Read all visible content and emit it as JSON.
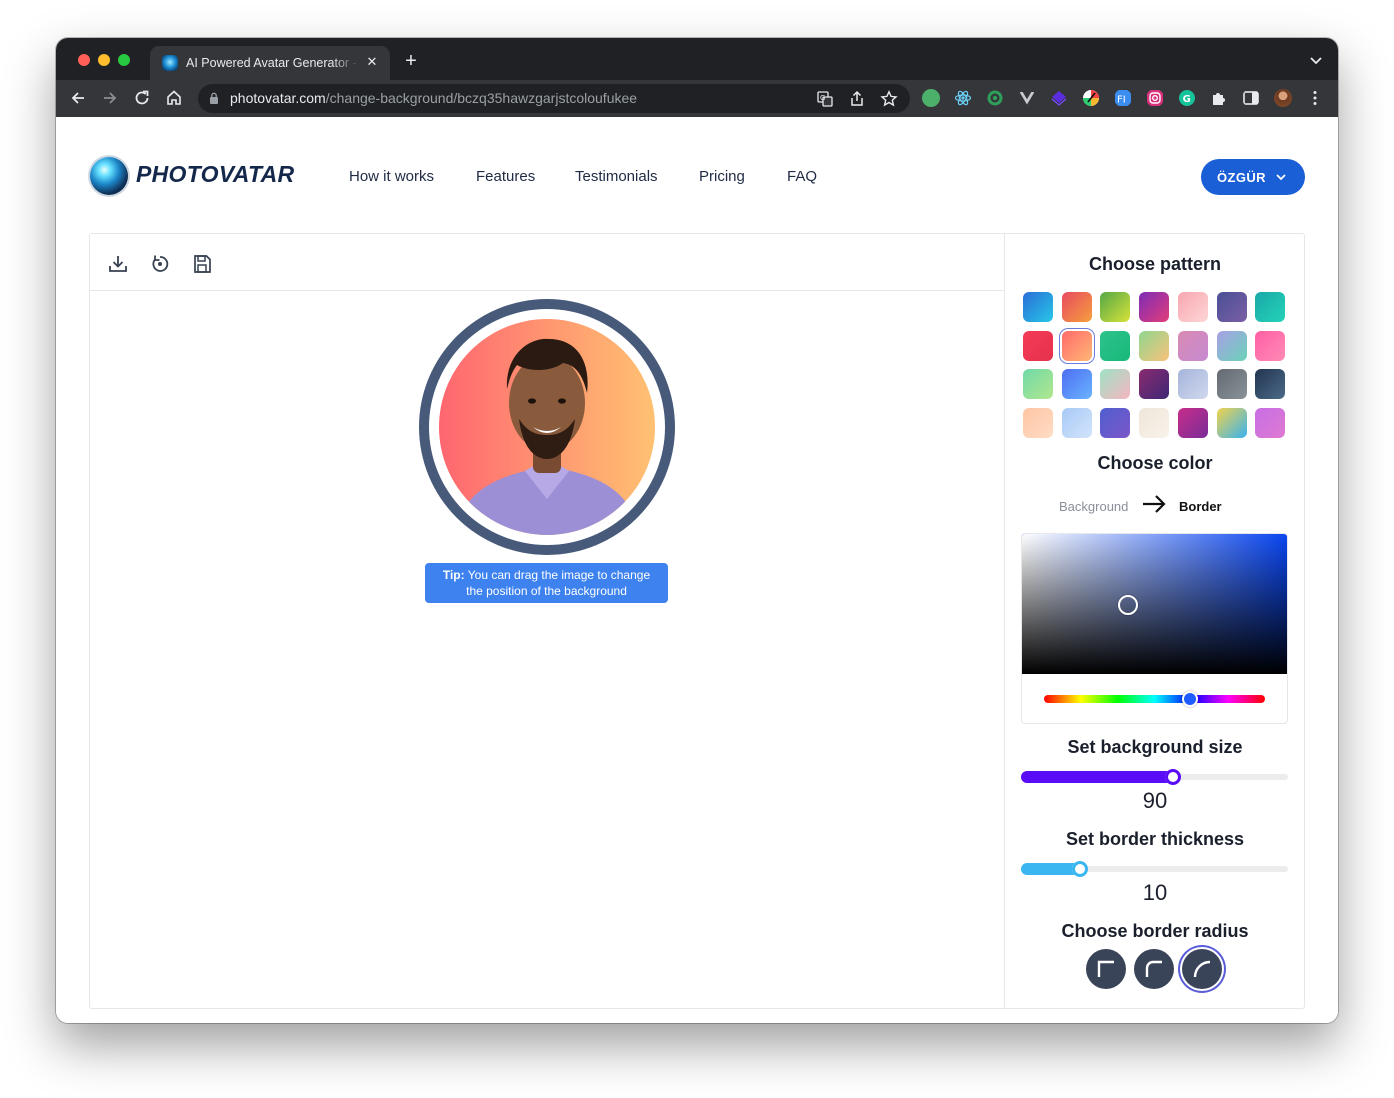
{
  "browser": {
    "tab_title": "AI Powered Avatar Generator -",
    "url_host": "photovatar.com",
    "url_path": "/change-background/bczq35hawzgarjstcoloufukee"
  },
  "site": {
    "logo_text": "PHOTOVATAR",
    "nav": [
      "How it works",
      "Features",
      "Testimonials",
      "Pricing",
      "FAQ"
    ],
    "user_button": "ÖZGÜR"
  },
  "editor": {
    "tip_bold": "Tip:",
    "tip_line1": " You can drag the image to change",
    "tip_line2": "the position of the background"
  },
  "panel": {
    "pattern_title": "Choose pattern",
    "color_title": "Choose color",
    "color_toggle_left": "Background",
    "color_toggle_right": "Border",
    "bg_size_title": "Set background size",
    "bg_size_value": "90",
    "bg_size_fraction": 0.57,
    "border_title": "Set border thickness",
    "border_value": "10",
    "border_fraction": 0.22,
    "radius_title": "Choose border radius",
    "selected_pattern_index": 8,
    "selected_radius_index": 2,
    "picker_hue_fraction": 0.66,
    "border_color": "#485a7a",
    "accent_color": "#1a5fd6",
    "slider_purple": "#5b0cf6",
    "slider_blue": "#3bb6f1"
  },
  "patterns": [
    "linear-gradient(135deg,#2a6ed6,#27c7e8)",
    "linear-gradient(135deg,#e84a5f,#f59f3e)",
    "linear-gradient(135deg,#54a846,#d7e23a)",
    "linear-gradient(135deg,#7d2cb6,#e23d7a)",
    "linear-gradient(135deg,#f8a6b0,#fdd6d6)",
    "linear-gradient(135deg,#4a4f95,#7b5fa5)",
    "linear-gradient(135deg,#1aa8a8,#24d3b9)",
    "linear-gradient(135deg,#f53b57,#e5324c)",
    "linear-gradient(135deg,#ff6a6a,#ffb877)",
    "linear-gradient(135deg,#2dc28a,#17b97a)",
    "linear-gradient(135deg,#8fd68f,#f9c27a)",
    "linear-gradient(135deg,#d98ab3,#c68ad2)",
    "linear-gradient(135deg,#a8a0e6,#6ad3b8)",
    "linear-gradient(135deg,#ff5fa4,#ff8ab6)",
    "linear-gradient(135deg,#6fd9a8,#b2e78d)",
    "linear-gradient(135deg,#4d6ef2,#6ab3ff)",
    "linear-gradient(135deg,#9fe2c5,#f5b5c0)",
    "linear-gradient(135deg,#8a2a6f,#3e2875)",
    "linear-gradient(135deg,#a6b4dc,#cfd8ec)",
    "linear-gradient(135deg,#636a72,#8a9299)",
    "linear-gradient(135deg,#233550,#4a6a88)",
    "linear-gradient(135deg,#ffc6a5,#ffdcc4)",
    "linear-gradient(135deg,#a7c9f6,#d3e4fb)",
    "linear-gradient(135deg,#4f5fd0,#7c56c9)",
    "linear-gradient(135deg,#efe6d9,#f8f2ea)",
    "linear-gradient(135deg,#c72d8a,#7a2d98)",
    "linear-gradient(135deg,#f2d34c,#37b2f0)",
    "linear-gradient(135deg,#c66ee4,#e07ad2)"
  ]
}
